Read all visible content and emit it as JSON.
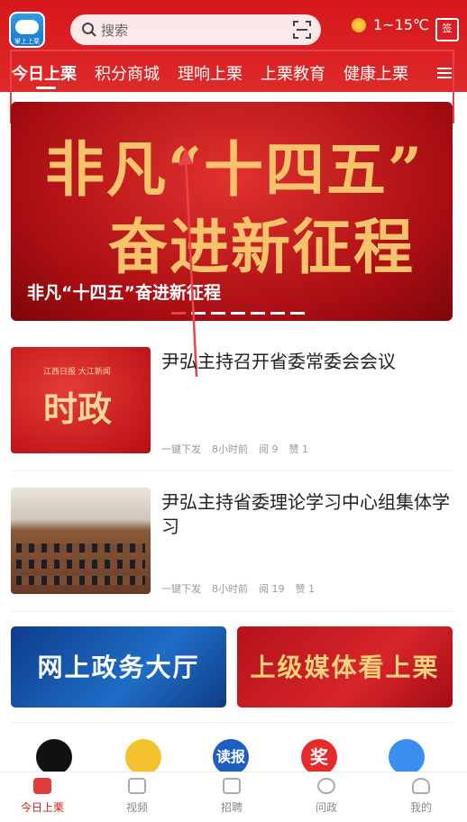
{
  "header": {
    "logo_text": "掌上上栗",
    "search_placeholder": "搜索",
    "weather": "1~15℃",
    "calendar_label": "签"
  },
  "tabs": [
    {
      "label": "今日上栗",
      "active": true
    },
    {
      "label": "积分商城"
    },
    {
      "label": "理响上栗"
    },
    {
      "label": "上栗教育"
    },
    {
      "label": "健康上栗"
    }
  ],
  "banner": {
    "big_line1": "非凡“十四五”",
    "big_line2": "奋进新征程",
    "caption": "非凡“十四五”奋进新征程"
  },
  "news": [
    {
      "title": "尹弘主持召开省委常委会会议",
      "thumb_small": "江西日报 大江新闻",
      "thumb_big": "时政",
      "source": "一键下发",
      "time": "8小时前",
      "reads": "阅 9",
      "likes": "赞 1"
    },
    {
      "title": "尹弘主持省委理论学习中心组集体学习",
      "source": "一键下发",
      "time": "8小时前",
      "reads": "阅 19",
      "likes": "赞 1"
    }
  ],
  "cards": [
    {
      "label": "网上政务大厅"
    },
    {
      "label": "上级媒体看上栗"
    }
  ],
  "quick_icons": [
    {
      "icon": "tiktok-icon",
      "text": ""
    },
    {
      "icon": "weibo-icon",
      "text": ""
    },
    {
      "icon": "dubao-icon",
      "text": "读报"
    },
    {
      "icon": "award-icon",
      "text": "奖"
    },
    {
      "icon": "clover-icon",
      "text": ""
    }
  ],
  "bottom_nav": [
    {
      "label": "今日上栗",
      "active": true
    },
    {
      "label": "视频"
    },
    {
      "label": "招聘"
    },
    {
      "label": "问政"
    },
    {
      "label": "我的"
    }
  ],
  "colors": {
    "brand": "#d6171c",
    "highlight": "#e8434a"
  }
}
